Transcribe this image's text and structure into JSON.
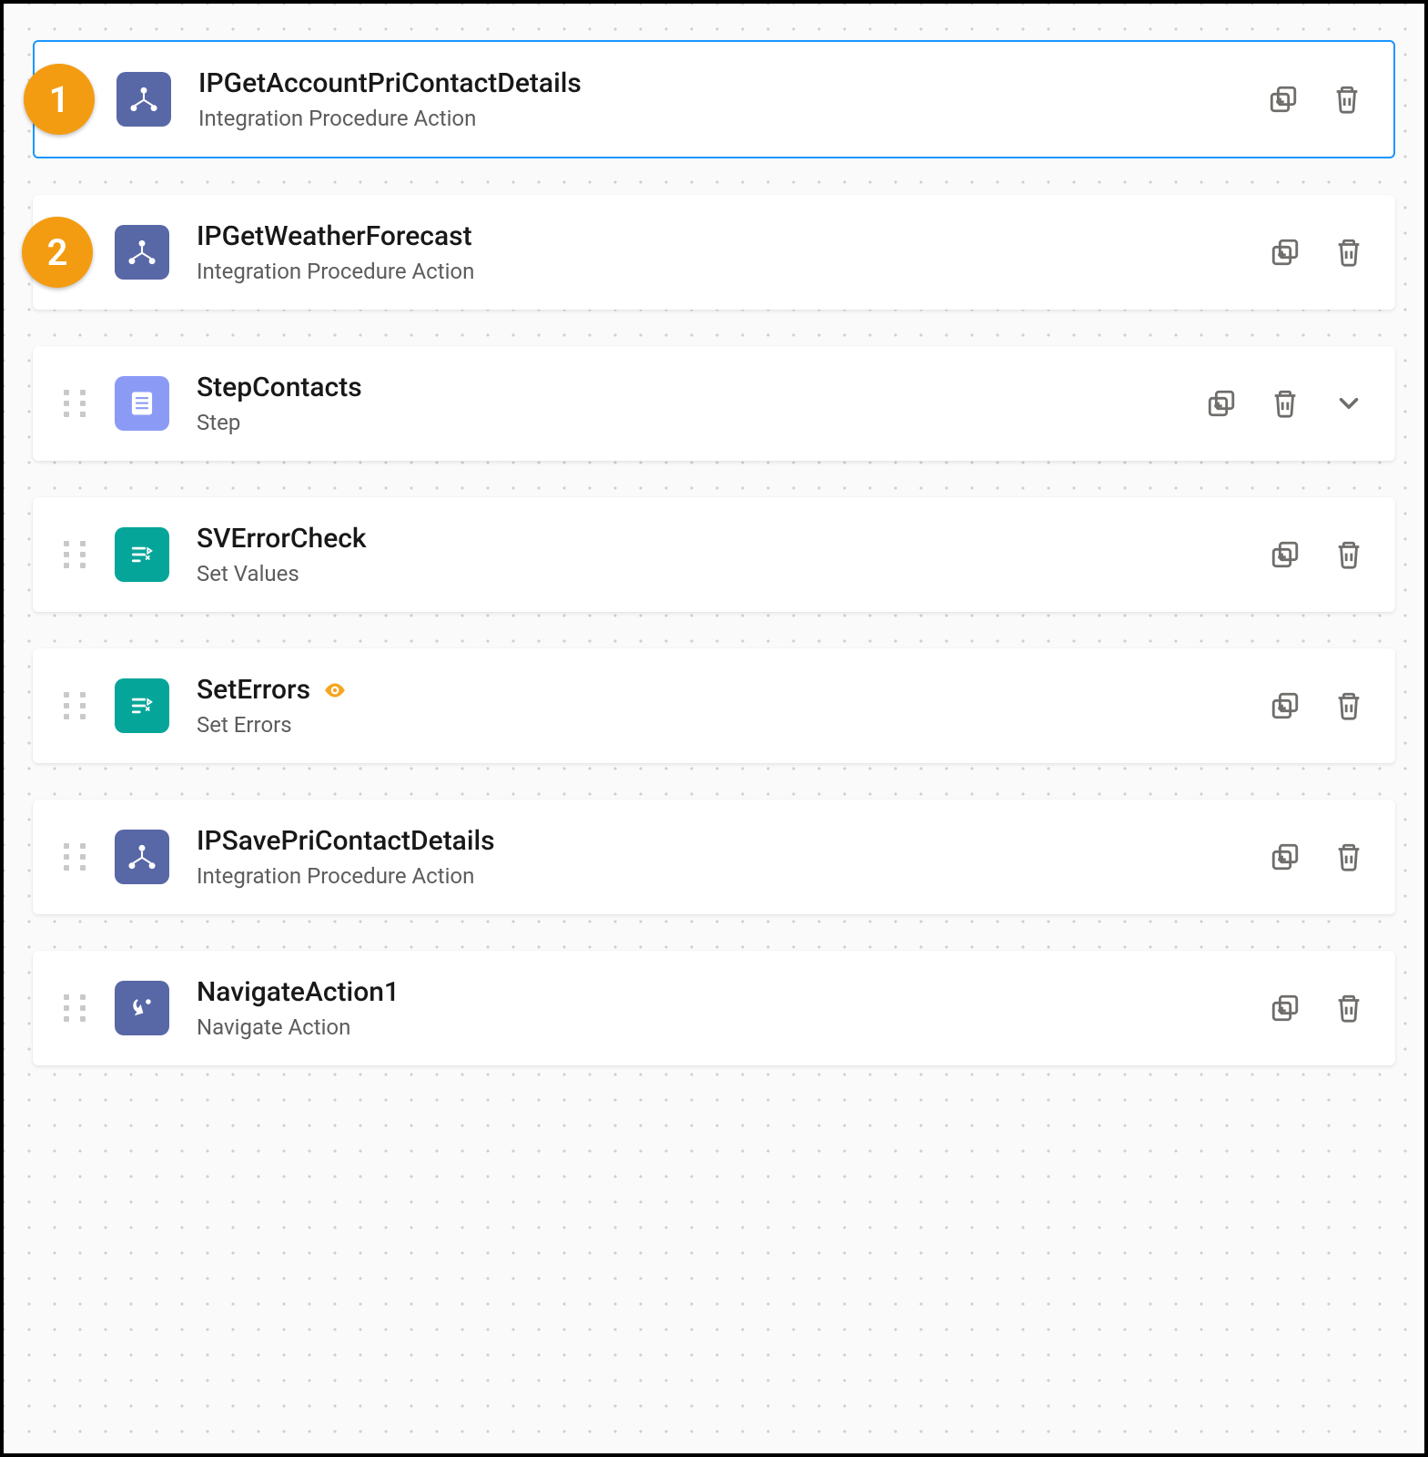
{
  "callouts": {
    "c1": "1",
    "c2": "2"
  },
  "items": [
    {
      "title": "IPGetAccountPriContactDetails",
      "subtitle": "Integration Procedure Action",
      "icon": "ip",
      "selected": true,
      "callout": "c1",
      "drag": false,
      "expand": false,
      "eye": false
    },
    {
      "title": "IPGetWeatherForecast",
      "subtitle": "Integration Procedure Action",
      "icon": "ip",
      "selected": false,
      "callout": "c2",
      "drag": false,
      "expand": false,
      "eye": false
    },
    {
      "title": "StepContacts",
      "subtitle": "Step",
      "icon": "step",
      "selected": false,
      "callout": null,
      "drag": true,
      "expand": true,
      "eye": false
    },
    {
      "title": "SVErrorCheck",
      "subtitle": "Set Values",
      "icon": "sv",
      "selected": false,
      "callout": null,
      "drag": true,
      "expand": false,
      "eye": false
    },
    {
      "title": "SetErrors",
      "subtitle": "Set Errors",
      "icon": "sv",
      "selected": false,
      "callout": null,
      "drag": true,
      "expand": false,
      "eye": true
    },
    {
      "title": "IPSavePriContactDetails",
      "subtitle": "Integration Procedure Action",
      "icon": "ip",
      "selected": false,
      "callout": null,
      "drag": true,
      "expand": false,
      "eye": false
    },
    {
      "title": "NavigateAction1",
      "subtitle": "Navigate Action",
      "icon": "nav",
      "selected": false,
      "callout": null,
      "drag": true,
      "expand": false,
      "eye": false
    }
  ]
}
